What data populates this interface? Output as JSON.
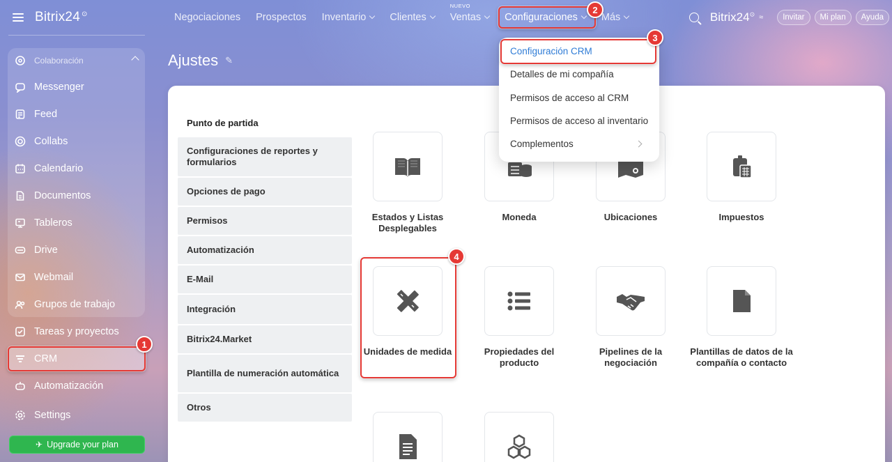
{
  "brand": {
    "name": "Bitrix24",
    "mark": "⊙"
  },
  "sidebar": {
    "group_label": "Colaboración",
    "items": [
      {
        "label": "Messenger",
        "icon": "chat-icon"
      },
      {
        "label": "Feed",
        "icon": "feed-icon"
      },
      {
        "label": "Collabs",
        "icon": "collabs-icon"
      },
      {
        "label": "Calendario",
        "icon": "calendar-icon"
      },
      {
        "label": "Documentos",
        "icon": "document-icon"
      },
      {
        "label": "Tableros",
        "icon": "board-icon"
      },
      {
        "label": "Drive",
        "icon": "drive-icon"
      },
      {
        "label": "Webmail",
        "icon": "mail-icon"
      },
      {
        "label": "Grupos de trabajo",
        "icon": "groups-icon"
      }
    ],
    "items_bottom": [
      {
        "label": "Tareas y proyectos",
        "icon": "tasks-icon"
      },
      {
        "label": "CRM",
        "icon": "crm-icon"
      },
      {
        "label": "Automatización",
        "icon": "automation-icon"
      },
      {
        "label": "Settings",
        "icon": "gear-icon"
      }
    ],
    "upgrade_label": "Upgrade your plan"
  },
  "topnav": {
    "items": [
      "Negociaciones",
      "Prospectos",
      "Inventario",
      "Clientes",
      "Ventas",
      "Configuraciones",
      "Más"
    ],
    "new_badge": "NUEVO",
    "brand": "Bitrix24",
    "invite": "Invitar",
    "plan": "Mi plan",
    "help": "Ayuda"
  },
  "page": {
    "title": "Ajustes"
  },
  "settings_menu": {
    "heading": "Punto de partida",
    "items": [
      "Configuraciones de reportes y formularios",
      "Opciones de pago",
      "Permisos",
      "Automatización",
      "E-Mail",
      "Integración",
      "Bitrix24.Market",
      "Plantilla de numeración automática",
      "Otros"
    ]
  },
  "tiles": [
    {
      "label": "Estados y Listas Desplegables",
      "icon": "book-icon"
    },
    {
      "label": "Moneda",
      "icon": "coins-icon"
    },
    {
      "label": "Ubicaciones",
      "icon": "map-pin-icon"
    },
    {
      "label": "Impuestos",
      "icon": "calculator-icon"
    },
    {
      "label": "Unidades de medida",
      "icon": "ruler-pencil-icon"
    },
    {
      "label": "Propiedades del producto",
      "icon": "list-icon"
    },
    {
      "label": "Pipelines de la negociación",
      "icon": "handshake-icon"
    },
    {
      "label": "Plantillas de datos de la compañía o contacto",
      "icon": "file-icon"
    },
    {
      "label": "",
      "icon": "doc-lines-icon"
    },
    {
      "label": "",
      "icon": "cubes-icon"
    }
  ],
  "dropdown": {
    "items": [
      "Configuración CRM",
      "Detalles de mi compañía",
      "Permisos de acceso al CRM",
      "Permisos de acceso al inventario",
      "Complementos"
    ]
  },
  "annotations": [
    "1",
    "2",
    "3",
    "4"
  ],
  "colors": {
    "accent": "#e53935",
    "link": "#2f7cd6",
    "upgrade": "#2fb64f"
  }
}
